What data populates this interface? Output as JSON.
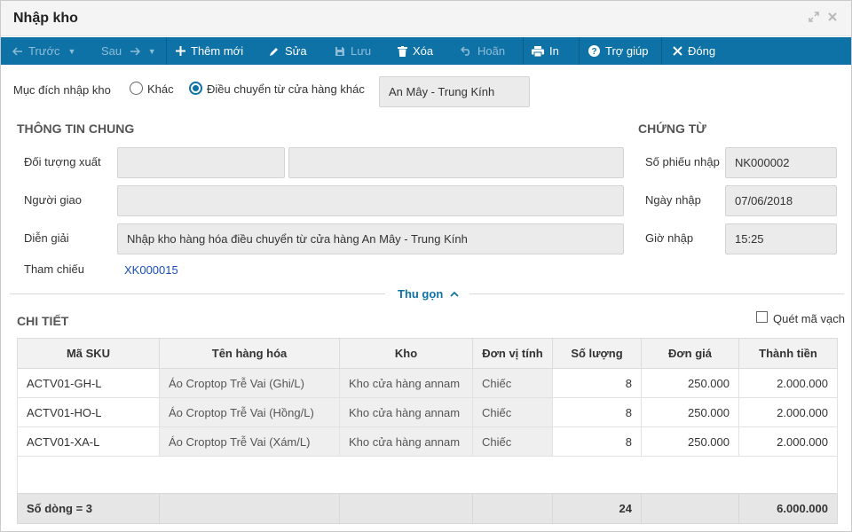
{
  "window": {
    "title": "Nhập kho"
  },
  "toolbar": {
    "prev_label": "Trước",
    "next_label": "Sau",
    "add_label": "Thêm mới",
    "edit_label": "Sửa",
    "save_label": "Lưu",
    "delete_label": "Xóa",
    "undo_label": "Hoãn",
    "print_label": "In",
    "help_label": "Trợ giúp",
    "close_label": "Đóng"
  },
  "purpose": {
    "label": "Mục đích nhập kho",
    "options": [
      "Khác",
      "Điều chuyển từ cửa hàng khác"
    ],
    "selected": "Điều chuyển từ cửa hàng khác",
    "store_value": "An Mây - Trung Kính"
  },
  "general_info": {
    "title": "THÔNG TIN CHUNG",
    "issuer_label": "Đối tượng xuất",
    "issuer_code": "",
    "issuer_name": "",
    "deliverer_label": "Người giao",
    "deliverer_value": "",
    "description_label": "Diễn giải",
    "description_value": "Nhập kho hàng hóa điều chuyển từ cửa hàng An Mây - Trung Kính",
    "reference_label": "Tham chiếu",
    "reference_value": "XK000015"
  },
  "voucher": {
    "title": "CHỨNG TỪ",
    "number_label": "Số phiếu nhập",
    "number_value": "NK000002",
    "date_label": "Ngày nhập",
    "date_value": "07/06/2018",
    "time_label": "Giờ nhập",
    "time_value": "15:25"
  },
  "collapse_label": "Thu gọn",
  "detail": {
    "title": "CHI TIẾT",
    "barcode_label": "Quét mã vạch",
    "columns": [
      "Mã SKU",
      "Tên hàng hóa",
      "Kho",
      "Đơn vị tính",
      "Số lượng",
      "Đơn giá",
      "Thành tiền"
    ],
    "rows": [
      {
        "sku": "ACTV01-GH-L",
        "name": "Áo Croptop Trễ Vai (Ghi/L)",
        "warehouse": "Kho cửa hàng annam",
        "unit": "Chiếc",
        "qty": "8",
        "price": "250.000",
        "amount": "2.000.000"
      },
      {
        "sku": "ACTV01-HO-L",
        "name": "Áo Croptop Trễ Vai (Hồng/L)",
        "warehouse": "Kho cửa hàng annam",
        "unit": "Chiếc",
        "qty": "8",
        "price": "250.000",
        "amount": "2.000.000"
      },
      {
        "sku": "ACTV01-XA-L",
        "name": "Áo Croptop Trễ Vai (Xám/L)",
        "warehouse": "Kho cửa hàng annam",
        "unit": "Chiếc",
        "qty": "8",
        "price": "250.000",
        "amount": "2.000.000"
      }
    ],
    "footer": {
      "row_count": "Số dòng = 3",
      "total_qty": "24",
      "total_amount": "6.000.000"
    }
  },
  "icons": {
    "prev": "arrow-left-icon",
    "next": "arrow-right-icon",
    "add": "plus-icon",
    "edit": "pencil-icon",
    "save": "floppy-icon",
    "delete": "trash-icon",
    "undo": "undo-icon",
    "print": "printer-icon",
    "help": "question-circle-icon",
    "close": "close-icon",
    "collapse": "chevron-up-icon",
    "maximize": "maximize-icon",
    "window_close": "window-close-icon"
  },
  "colors": {
    "toolbar": "#0e72a6",
    "accent": "#0e72a6",
    "link": "#1a4fb5"
  }
}
